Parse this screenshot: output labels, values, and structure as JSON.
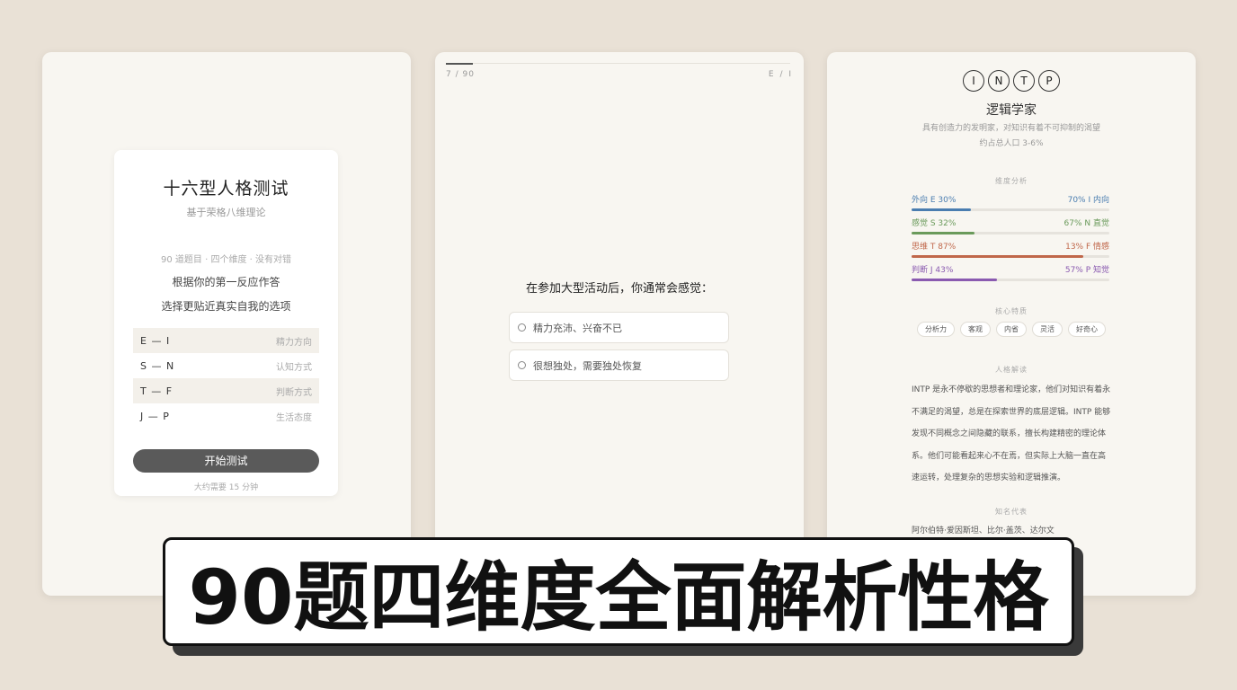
{
  "intro": {
    "title": "十六型人格测试",
    "subtitle": "基于荣格八维理论",
    "meta": "90 道题目 · 四个维度 · 没有对错",
    "line1": "根据你的第一反应作答",
    "line2": "选择更贴近真实自我的选项",
    "dimensions": [
      {
        "code": "E — I",
        "desc": "精力方向"
      },
      {
        "code": "S — N",
        "desc": "认知方式"
      },
      {
        "code": "T — F",
        "desc": "判断方式"
      },
      {
        "code": "J — P",
        "desc": "生活态度"
      }
    ],
    "start_label": "开始测试",
    "duration": "大约需要 15 分钟"
  },
  "quiz": {
    "counter": "7 / 90",
    "dimension": "E / I",
    "progress": 0.078,
    "question": "在参加大型活动后，你通常会感觉：",
    "options": [
      "精力充沛、兴奋不已",
      "很想独处，需要独处恢复"
    ]
  },
  "result": {
    "letters": [
      "I",
      "N",
      "T",
      "P"
    ],
    "name": "逻辑学家",
    "description": "具有创造力的发明家，对知识有着不可抑制的渴望",
    "ratio": "约占总人口 3-6%",
    "dimension_label": "维度分析",
    "bars": [
      {
        "left": "外向 E  30%",
        "right": "70%  I 内向",
        "value": 0.3,
        "color": "#4a7db0"
      },
      {
        "left": "感觉 S  32%",
        "right": "67%  N 直觉",
        "value": 0.32,
        "color": "#6a9a5b"
      },
      {
        "left": "思维 T  87%",
        "right": "13%  F 情感",
        "value": 0.87,
        "color": "#c0674a"
      },
      {
        "left": "判断 J  43%",
        "right": "57%  P 知觉",
        "value": 0.43,
        "color": "#8a5ab0"
      }
    ],
    "traits_label": "核心特质",
    "traits": [
      "分析力",
      "客观",
      "内省",
      "灵活",
      "好奇心"
    ],
    "analysis_label": "人格解读",
    "analysis": "INTP 是永不停歇的思想者和理论家，他们对知识有着永不满足的渴望，总是在探索世界的底层逻辑。INTP 能够发现不同概念之间隐藏的联系，擅长构建精密的理论体系。他们可能看起来心不在焉，但实际上大脑一直在高速运转，处理复杂的思想实验和逻辑推演。",
    "famous_label": "知名代表",
    "famous": "阿尔伯特·爱因斯坦、比尔·盖茨、达尔文"
  },
  "banner": {
    "text": "90题四维度全面解析性格"
  }
}
